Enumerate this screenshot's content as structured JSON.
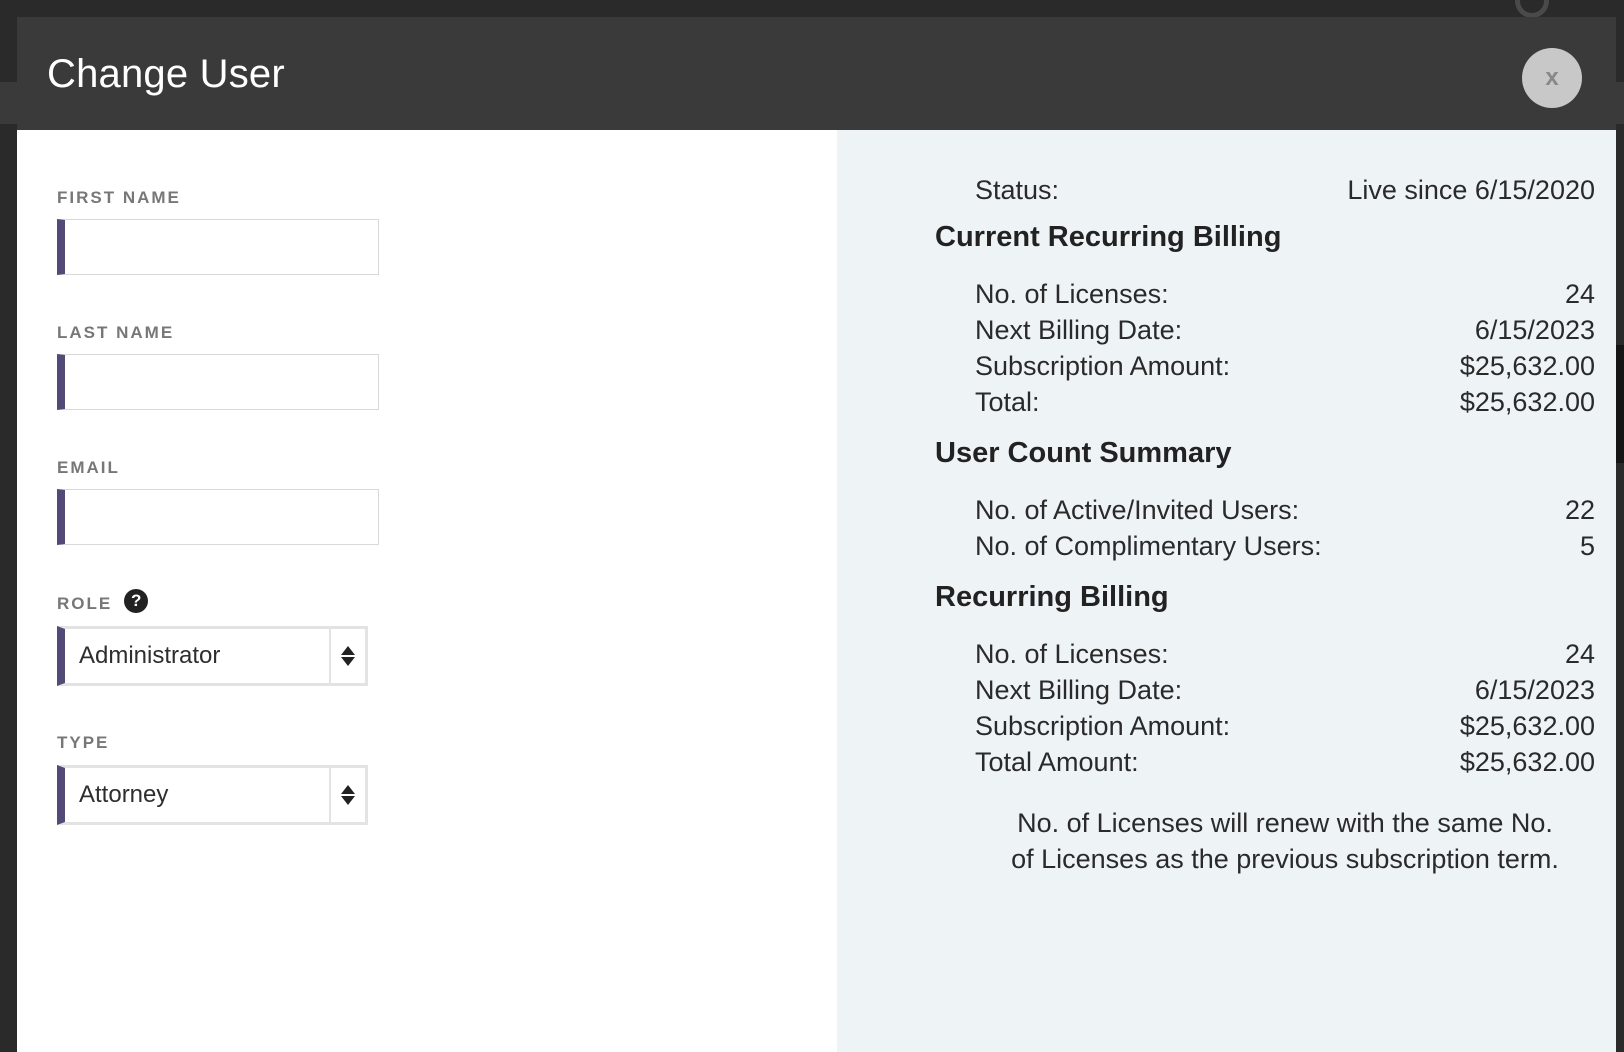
{
  "modal": {
    "title": "Change User",
    "close_label": "x"
  },
  "form": {
    "first_name": {
      "label": "FIRST NAME",
      "value": "",
      "placeholder": ""
    },
    "last_name": {
      "label": "LAST NAME",
      "value": "",
      "placeholder": ""
    },
    "email": {
      "label": "EMAIL",
      "value": "",
      "placeholder": ""
    },
    "role": {
      "label": "ROLE",
      "help_glyph": "?",
      "selected": "Administrator"
    },
    "type": {
      "label": "TYPE",
      "selected": "Attorney"
    }
  },
  "info": {
    "status": {
      "label": "Status:",
      "value": "Live since 6/15/2020"
    },
    "current_billing": {
      "heading": "Current Recurring Billing",
      "rows": [
        {
          "label": "No. of Licenses:",
          "value": "24"
        },
        {
          "label": "Next Billing Date:",
          "value": "6/15/2023"
        },
        {
          "label": "Subscription Amount:",
          "value": "$25,632.00"
        },
        {
          "label": "Total:",
          "value": "$25,632.00"
        }
      ]
    },
    "user_count": {
      "heading": "User Count Summary",
      "rows": [
        {
          "label": "No. of Active/Invited Users:",
          "value": "22"
        },
        {
          "label": "No. of Complimentary Users:",
          "value": "5"
        }
      ]
    },
    "recurring_billing": {
      "heading": "Recurring Billing",
      "rows": [
        {
          "label": "No. of Licenses:",
          "value": "24"
        },
        {
          "label": "Next Billing Date:",
          "value": "6/15/2023"
        },
        {
          "label": "Subscription Amount:",
          "value": "$25,632.00"
        },
        {
          "label": "Total Amount:",
          "value": "$25,632.00"
        }
      ]
    },
    "renew_note_line1": "No. of Licenses will renew with the same No.",
    "renew_note_line2": "of Licenses as the previous subscription term."
  },
  "colors": {
    "header_bg": "#3a3a3a",
    "input_accent": "#544a78",
    "info_panel_bg": "#eef4f6"
  }
}
